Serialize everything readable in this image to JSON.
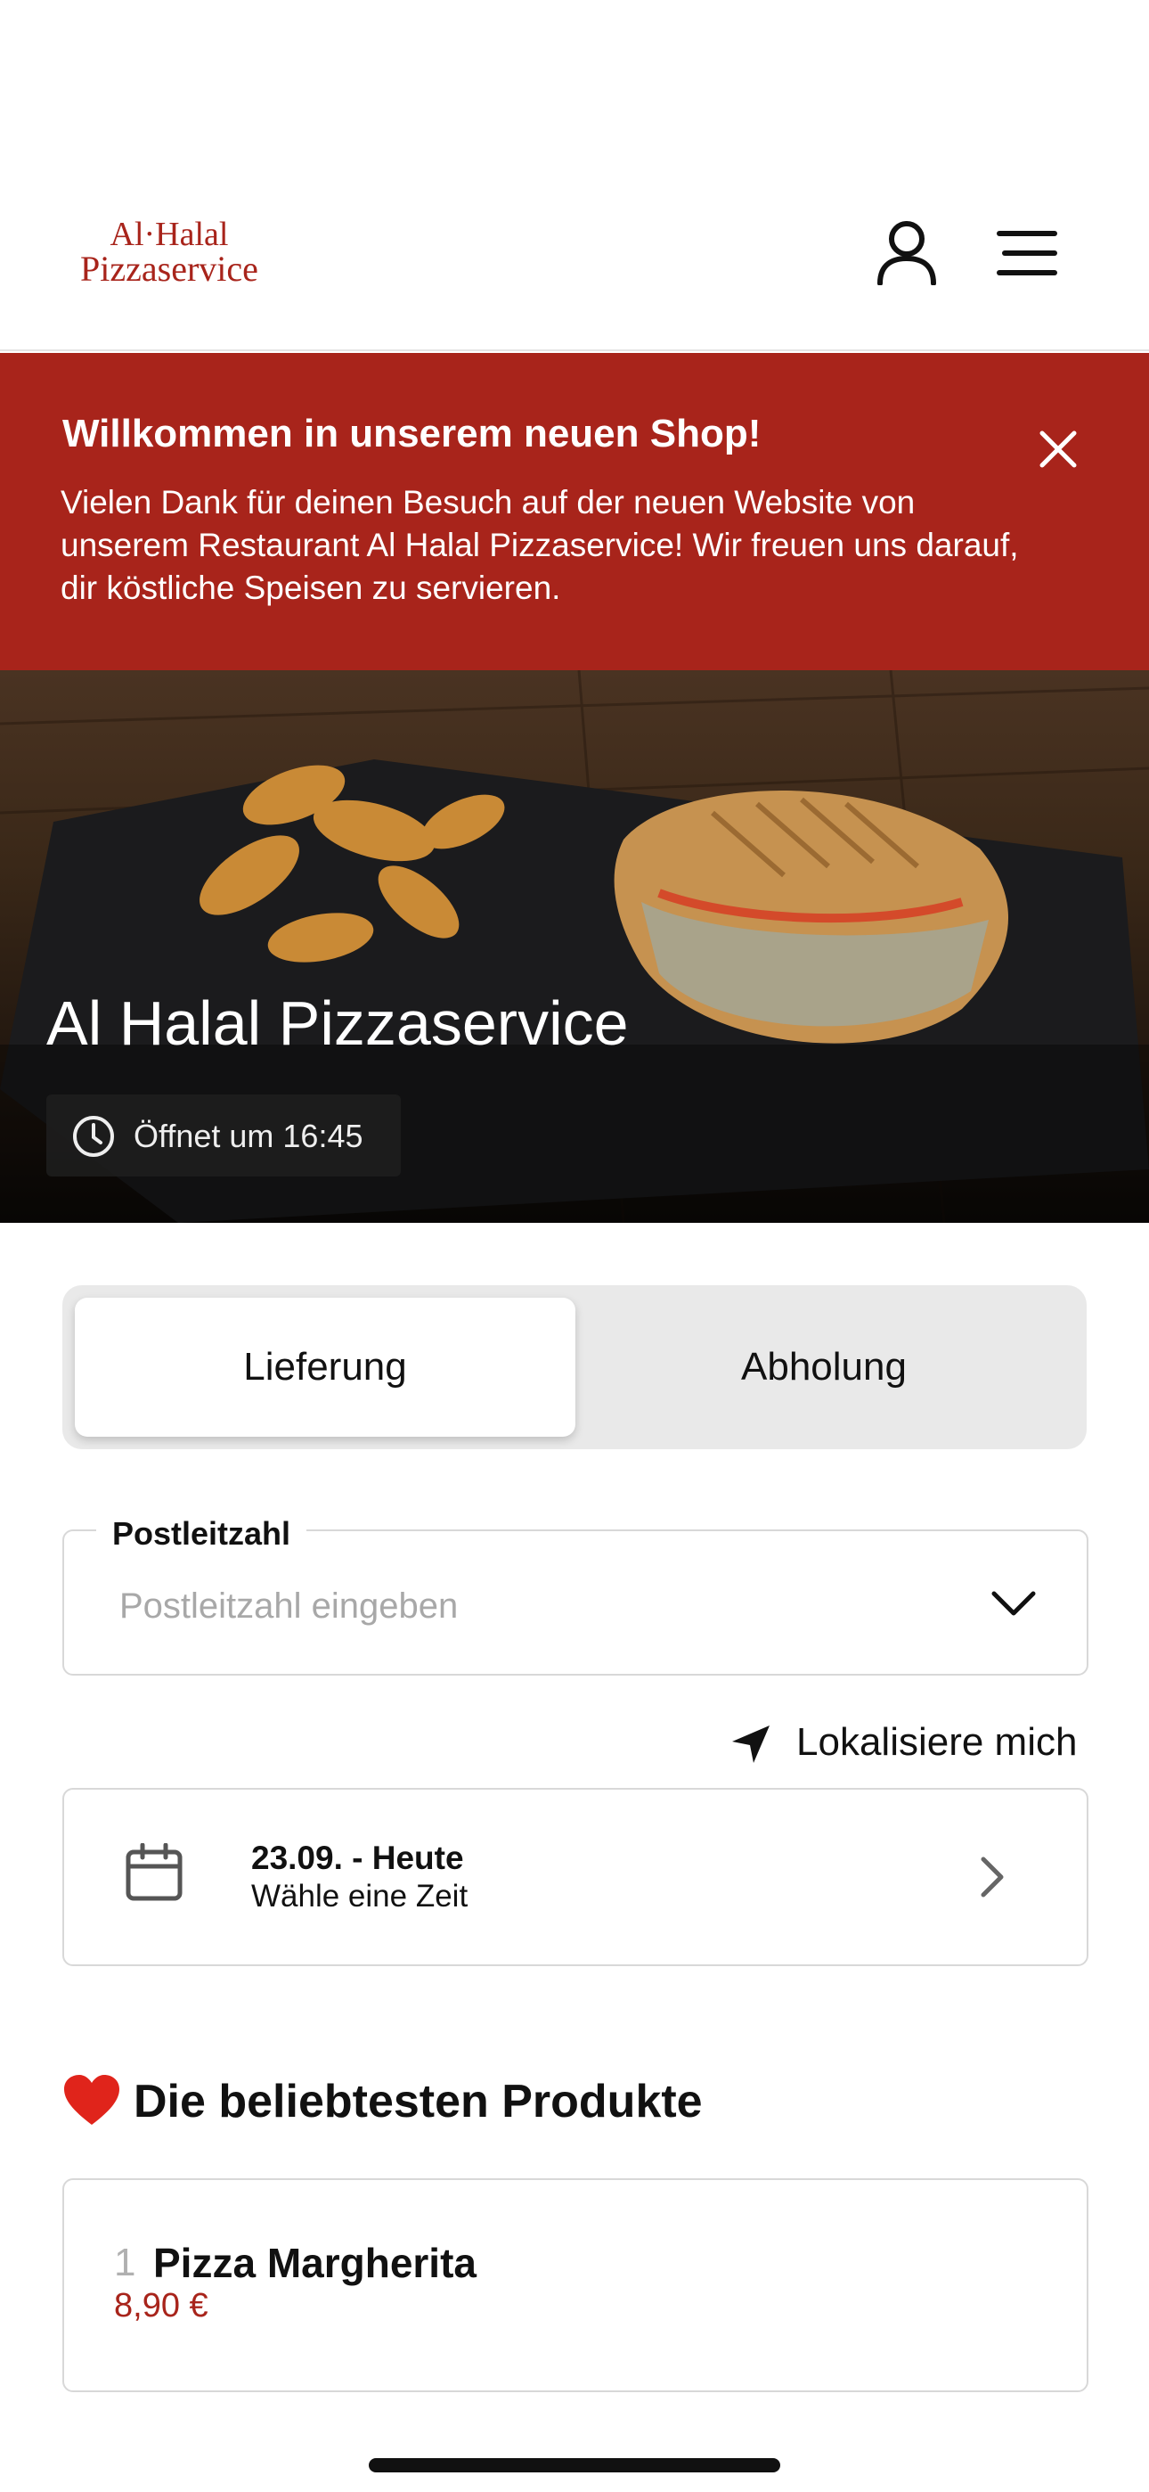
{
  "header": {
    "logo_line1": "Al·Halal",
    "logo_line2": "Pizzaservice"
  },
  "banner": {
    "title": "Willkommen in unserem neuen Shop!",
    "text": "Vielen Dank für deinen Besuch auf der neuen Website von unserem Restaurant Al Halal Pizzaservice! Wir freuen uns darauf, dir köstliche Speisen zu servieren."
  },
  "hero": {
    "title": "Al Halal Pizzaservice",
    "opening": "Öffnet um 16:45"
  },
  "order_mode": {
    "tabs": [
      {
        "label": "Lieferung",
        "active": true
      },
      {
        "label": "Abholung",
        "active": false
      }
    ]
  },
  "postcode": {
    "label": "Postleitzahl",
    "placeholder": "Postleitzahl eingeben"
  },
  "locate": {
    "label": "Lokalisiere mich"
  },
  "time": {
    "date": "23.09. - Heute",
    "prompt": "Wähle eine Zeit"
  },
  "popular": {
    "title": "Die beliebtesten Produkte",
    "products": [
      {
        "rank": "1",
        "name": "Pizza Margherita",
        "price": "8,90 €"
      }
    ]
  },
  "colors": {
    "brand": "#a8241b",
    "text": "#111111",
    "muted": "#a8a8a8"
  }
}
